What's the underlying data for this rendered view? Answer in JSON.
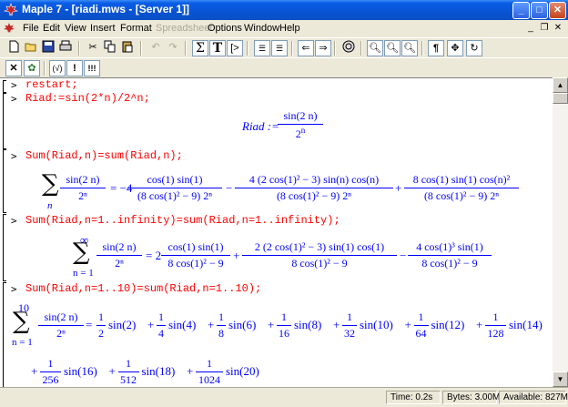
{
  "window": {
    "title": "Maple 7 - [riadi.mws - [Server 1]]",
    "minimize": "_",
    "maximize": "□",
    "close": "✕"
  },
  "menu": [
    "File",
    "Edit",
    "View",
    "Insert",
    "Format",
    "Spreadsheet",
    "Options",
    "Window",
    "Help"
  ],
  "toolbar2": {
    "exec_label": "(√)",
    "bang": "!",
    "triple_bang": "!!!"
  },
  "status": {
    "time": "Time:  0.2s",
    "bytes": "Bytes: 3.00M",
    "available": "Available: 827M"
  },
  "doc": {
    "prompt": ">",
    "cmd1": "restart;",
    "cmd2": "Riad:=sin(2*n)/2^n;",
    "out2_lhs": "Riad :=",
    "out2_num": "sin(2 n)",
    "out2_den": "2",
    "out2_den_exp": "n",
    "cmd3": "Sum(Riad,n)=sum(Riad,n);",
    "out3": {
      "sum_index": "n",
      "f0_num": "sin(2 n)",
      "f0_den": "2ⁿ",
      "eq": "= −4",
      "f1_num": "cos(1) sin(1)",
      "f1_den": "(8 cos(1)² − 9) 2ⁿ",
      "minus": "−",
      "f2_num": "4 (2 cos(1)² − 3) sin(n) cos(n)",
      "f2_den": "(8 cos(1)² − 9) 2ⁿ",
      "plus": "+",
      "f3_num": "8 cos(1) sin(1) cos(n)²",
      "f3_den": "(8 cos(1)² − 9) 2ⁿ"
    },
    "cmd4": "Sum(Riad,n=1..infinity)=sum(Riad,n=1..infinity);",
    "out4": {
      "sum_upper": "∞",
      "sum_lower": "n = 1",
      "f0_num": "sin(2 n)",
      "f0_den": "2ⁿ",
      "eq": "= 2",
      "f1_num": "cos(1) sin(1)",
      "f1_den": "8 cos(1)² − 9",
      "plus": "+",
      "f2_num": "2 (2 cos(1)² − 3) sin(1) cos(1)",
      "f2_den": "8 cos(1)² − 9",
      "minus": "−",
      "f3_num": "4 cos(1)³ sin(1)",
      "f3_den": "8 cos(1)² − 9"
    },
    "cmd5": "Sum(Riad,n=1..10)=sum(Riad,n=1..10);",
    "out5": {
      "sum_upper": "10",
      "sum_lower": "n = 1",
      "f0_num": "sin(2 n)",
      "f0_den": "2ⁿ",
      "eq": "=",
      "terms": [
        {
          "den": "2",
          "fn": "sin(2)",
          "sign": ""
        },
        {
          "den": "4",
          "fn": "sin(4)",
          "sign": "+"
        },
        {
          "den": "8",
          "fn": "sin(6)",
          "sign": "+"
        },
        {
          "den": "16",
          "fn": "sin(8)",
          "sign": "+"
        },
        {
          "den": "32",
          "fn": "sin(10)",
          "sign": "+"
        },
        {
          "den": "64",
          "fn": "sin(12)",
          "sign": "+"
        },
        {
          "den": "128",
          "fn": "sin(14)",
          "sign": "+"
        }
      ],
      "terms2": [
        {
          "den": "256",
          "fn": "sin(16)",
          "sign": "+"
        },
        {
          "den": "512",
          "fn": "sin(18)",
          "sign": "+"
        },
        {
          "den": "1024",
          "fn": "sin(20)",
          "sign": "+"
        }
      ],
      "one": "1"
    }
  }
}
